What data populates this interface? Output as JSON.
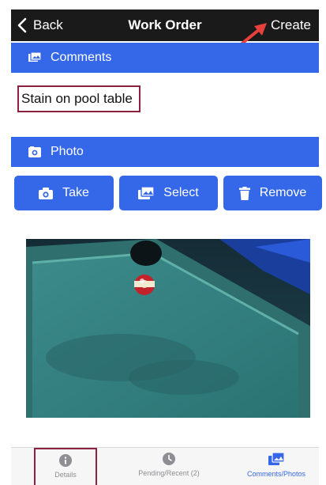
{
  "navbar": {
    "back_label": "Back",
    "title": "Work Order",
    "create_label": "Create"
  },
  "comments_section": {
    "header_label": "Comments",
    "comment_text": "Stain on pool table"
  },
  "photo_section": {
    "header_label": "Photo",
    "buttons": [
      {
        "label": "Take",
        "icon": "camera-icon"
      },
      {
        "label": "Select",
        "icon": "gallery-icon"
      },
      {
        "label": "Remove",
        "icon": "trash-icon"
      }
    ]
  },
  "tabbar": {
    "tabs": [
      {
        "label": "Details",
        "icon": "info-icon",
        "active": false
      },
      {
        "label": "Pending/Recent (2)",
        "icon": "clock-icon",
        "active": false
      },
      {
        "label": "Comments/Photos",
        "icon": "photos-icon",
        "active": true
      }
    ]
  },
  "colors": {
    "accent": "#3568e8",
    "navbar": "#1a1a1a",
    "highlight_box": "#8a2240",
    "annotation_arrow": "#e8413c"
  }
}
